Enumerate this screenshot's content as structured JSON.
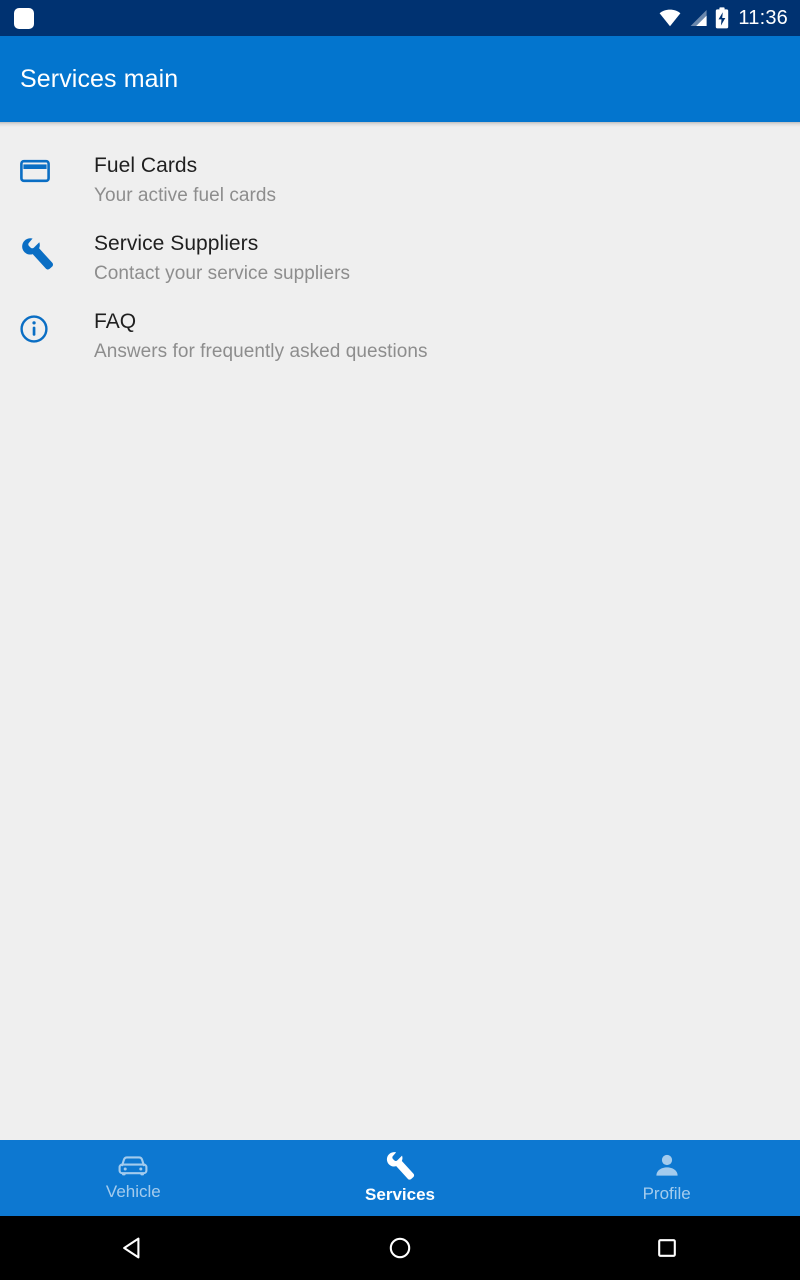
{
  "status_bar": {
    "notification_icon": "notification-dot-icon",
    "wifi_icon": "wifi-icon",
    "signal_icon": "cellular-signal-icon",
    "battery_icon": "battery-charging-icon",
    "time": "11:36",
    "background_color": "#003271"
  },
  "app_bar": {
    "title": "Services main",
    "background_color": "#0375ce",
    "text_color": "#ffffff"
  },
  "content": {
    "background_color": "#efefef",
    "items": [
      {
        "icon": "credit-card-icon",
        "title": "Fuel Cards",
        "subtitle": "Your active fuel cards"
      },
      {
        "icon": "wrench-icon",
        "title": "Service Suppliers",
        "subtitle": "Contact your service suppliers"
      },
      {
        "icon": "info-circle-icon",
        "title": "FAQ",
        "subtitle": "Answers for frequently asked questions"
      }
    ],
    "icon_color": "#0a6ec4",
    "title_color": "#1f1f1f",
    "subtitle_color": "#8d8d8d"
  },
  "bottom_nav": {
    "background_color": "#0d78d1",
    "items": [
      {
        "icon": "car-icon",
        "label": "Vehicle",
        "active": false
      },
      {
        "icon": "wrench-icon",
        "label": "Services",
        "active": true
      },
      {
        "icon": "person-icon",
        "label": "Profile",
        "active": false
      }
    ]
  },
  "system_nav": {
    "background_color": "#000000",
    "buttons": [
      {
        "icon": "back-triangle-icon",
        "label": "Back"
      },
      {
        "icon": "home-circle-icon",
        "label": "Home"
      },
      {
        "icon": "recents-square-icon",
        "label": "Recents"
      }
    ]
  }
}
